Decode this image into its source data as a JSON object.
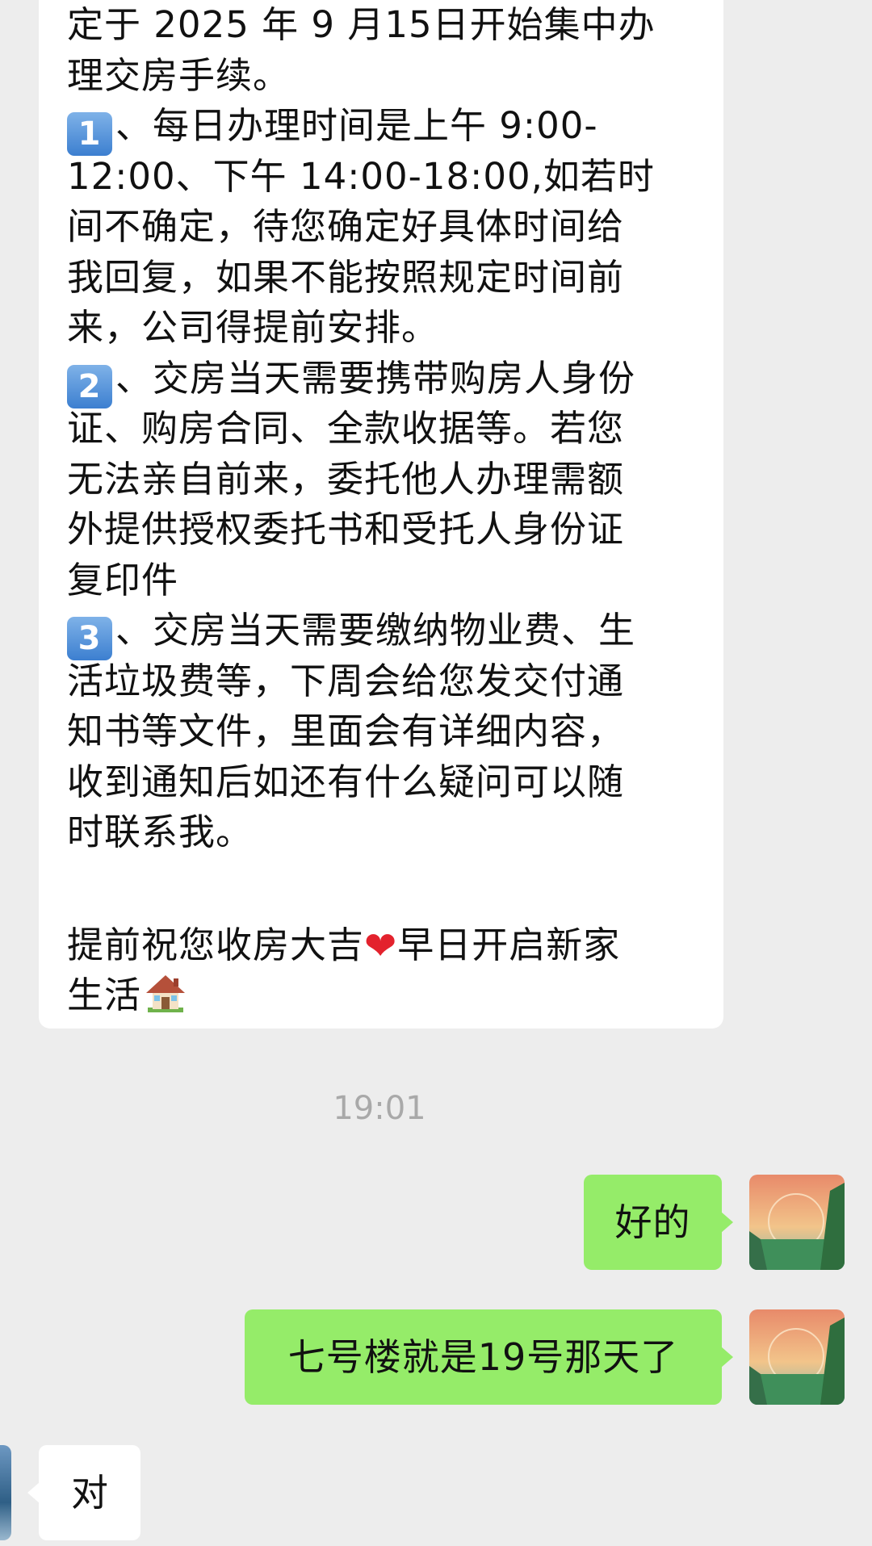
{
  "incoming_long_message": {
    "lines": [
      "定于 2025 年 9 月15日开始集中办",
      "理交房手续。",
      "、每日办理时间是上午 9:00-",
      "12:00、下午 14:00-18:00,如若时",
      "间不确定，待您确定好具体时间给",
      "我回复，如果不能按照规定时间前",
      "来，公司得提前安排。",
      "、交房当天需要携带购房人身份",
      "证、购房合同、全款收据等。若您",
      "无法亲自前来，委托他人办理需额",
      "外提供授权委托书和受托人身份证",
      "复印件",
      "、交房当天需要缴纳物业费、生",
      "活垃圾费等，下周会给您发交付通",
      "知书等文件，里面会有详细内容，",
      "收到通知后如还有什么疑问可以随",
      "时联系我。",
      "",
      "提前祝您收房大吉",
      "早日开启新家",
      "生活"
    ],
    "badges": [
      "1",
      "2",
      "3"
    ]
  },
  "timestamp": "19:01",
  "outgoing_messages": [
    {
      "text": "好的"
    },
    {
      "text": "七号楼就是19号那天了"
    }
  ],
  "incoming_short_message": {
    "text": "对"
  },
  "colors": {
    "background": "#ededed",
    "incoming_bubble": "#ffffff",
    "outgoing_bubble": "#95ec69",
    "timestamp": "#a9a9a9",
    "heart": "#e3222d"
  },
  "icons": {
    "number_badge": "keycap-number-icon",
    "heart": "red-heart-icon",
    "house": "house-icon",
    "avatar": "landscape-avatar"
  }
}
